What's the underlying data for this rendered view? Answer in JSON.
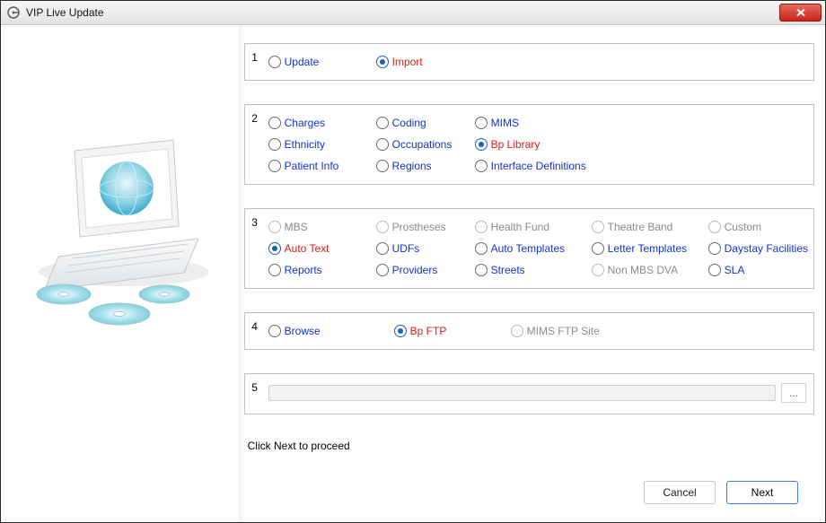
{
  "window": {
    "title": "VIP Live Update",
    "close_label": "Close"
  },
  "steps": {
    "s1": {
      "num": "1",
      "options": [
        {
          "key": "update",
          "label": "Update",
          "selected": false,
          "disabled": false
        },
        {
          "key": "import",
          "label": "Import",
          "selected": true,
          "disabled": false
        }
      ]
    },
    "s2": {
      "num": "2",
      "rows": [
        [
          {
            "key": "charges",
            "label": "Charges",
            "selected": false
          },
          {
            "key": "coding",
            "label": "Coding",
            "selected": false
          },
          {
            "key": "mims",
            "label": "MIMS",
            "selected": false
          }
        ],
        [
          {
            "key": "ethnicity",
            "label": "Ethnicity",
            "selected": false
          },
          {
            "key": "occupations",
            "label": "Occupations",
            "selected": false
          },
          {
            "key": "bp-library",
            "label": "Bp Library",
            "selected": true
          }
        ],
        [
          {
            "key": "patient-info",
            "label": "Patient Info",
            "selected": false
          },
          {
            "key": "regions",
            "label": "Regions",
            "selected": false
          },
          {
            "key": "interface-definitions",
            "label": "Interface Definitions",
            "selected": false
          }
        ]
      ]
    },
    "s3": {
      "num": "3",
      "rows": [
        [
          {
            "key": "mbs",
            "label": "MBS",
            "selected": false,
            "disabled": true
          },
          {
            "key": "prostheses",
            "label": "Prostheses",
            "selected": false,
            "disabled": true
          },
          {
            "key": "health-fund",
            "label": "Health Fund",
            "selected": false,
            "disabled": true
          },
          {
            "key": "theatre-band",
            "label": "Theatre Band",
            "selected": false,
            "disabled": true
          },
          {
            "key": "custom",
            "label": "Custom",
            "selected": false,
            "disabled": true
          }
        ],
        [
          {
            "key": "auto-text",
            "label": "Auto Text",
            "selected": true,
            "disabled": false
          },
          {
            "key": "udfs",
            "label": "UDFs",
            "selected": false,
            "disabled": false
          },
          {
            "key": "auto-templates",
            "label": "Auto Templates",
            "selected": false,
            "disabled": false
          },
          {
            "key": "letter-templates",
            "label": "Letter Templates",
            "selected": false,
            "disabled": false
          },
          {
            "key": "daystay-facilities",
            "label": "Daystay Facilities",
            "selected": false,
            "disabled": false
          }
        ],
        [
          {
            "key": "reports",
            "label": "Reports",
            "selected": false,
            "disabled": false
          },
          {
            "key": "providers",
            "label": "Providers",
            "selected": false,
            "disabled": false
          },
          {
            "key": "streets",
            "label": "Streets",
            "selected": false,
            "disabled": false
          },
          {
            "key": "non-mbs-dva",
            "label": "Non MBS DVA",
            "selected": false,
            "disabled": true
          },
          {
            "key": "sla",
            "label": "SLA",
            "selected": false,
            "disabled": false
          }
        ]
      ]
    },
    "s4": {
      "num": "4",
      "options": [
        {
          "key": "browse",
          "label": "Browse",
          "selected": false,
          "disabled": false
        },
        {
          "key": "bp-ftp",
          "label": "Bp FTP",
          "selected": true,
          "disabled": false
        },
        {
          "key": "mims-ftp",
          "label": "MIMS FTP Site",
          "selected": false,
          "disabled": true
        }
      ]
    },
    "s5": {
      "num": "5",
      "path_value": "",
      "browse_label": "..."
    }
  },
  "instruction": "Click Next to proceed",
  "footer": {
    "cancel": "Cancel",
    "next": "Next"
  }
}
